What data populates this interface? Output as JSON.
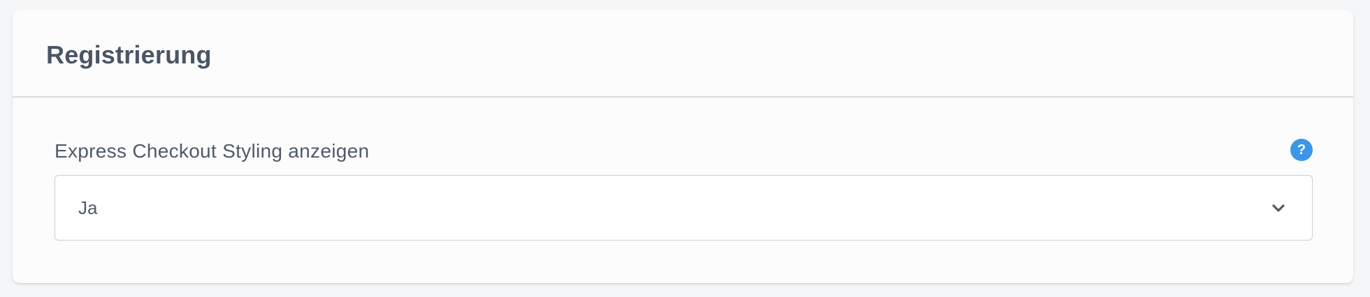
{
  "section": {
    "title": "Registrierung"
  },
  "field": {
    "label": "Express Checkout Styling anzeigen",
    "selected_value": "Ja",
    "help_icon_glyph": "?"
  },
  "colors": {
    "help_icon": "#3c96e8",
    "text": "#4f5b6b",
    "title": "#4a5665"
  },
  "icons": {
    "help": "question-circle-icon",
    "dropdown": "chevron-down-icon"
  }
}
